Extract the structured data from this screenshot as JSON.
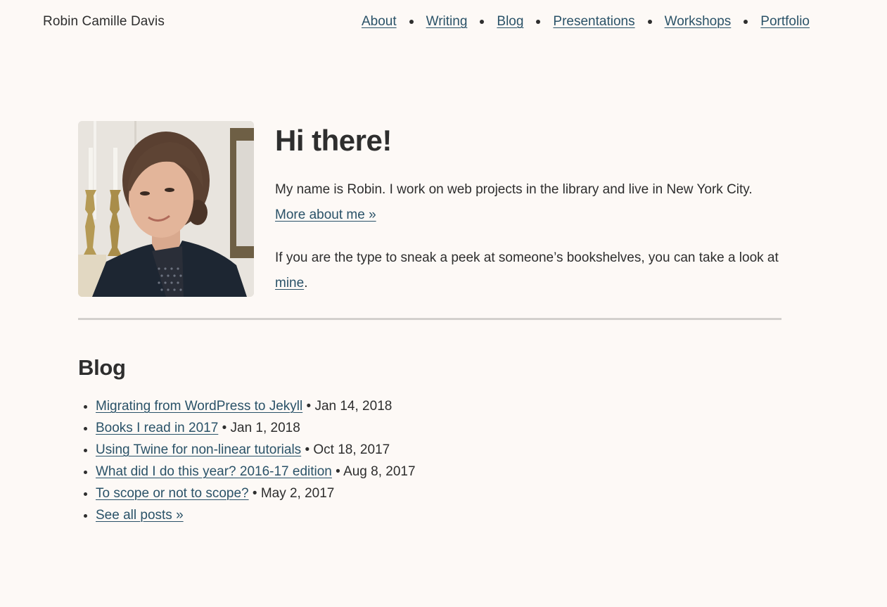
{
  "header": {
    "site_title": "Robin Camille Davis",
    "nav": [
      {
        "label": "About"
      },
      {
        "label": "Writing"
      },
      {
        "label": "Blog"
      },
      {
        "label": "Presentations"
      },
      {
        "label": "Workshops"
      },
      {
        "label": "Portfolio"
      }
    ]
  },
  "intro": {
    "photo_alt": "Portrait of Robin Camille Davis",
    "heading": "Hi there!",
    "p1_text": "My name is Robin. I work on web projects in the library and live in New York City.",
    "p1_link": "More about me »",
    "p2_text": "If you are the type to sneak a peek at someone’s bookshelves, you can take a look at",
    "p2_link": "mine",
    "p2_end": "."
  },
  "blog": {
    "heading": "Blog",
    "separator": "•",
    "posts": [
      {
        "title": "Migrating from WordPress to Jekyll",
        "date": "Jan 14, 2018"
      },
      {
        "title": "Books I read in 2017",
        "date": "Jan 1, 2018"
      },
      {
        "title": "Using Twine for non-linear tutorials",
        "date": "Oct 18, 2017"
      },
      {
        "title": "What did I do this year? 2016-17 edition",
        "date": "Aug 8, 2017"
      },
      {
        "title": "To scope or not to scope?",
        "date": "May 2, 2017"
      }
    ],
    "see_all": "See all posts »"
  },
  "colors": {
    "background": "#fdf9f6",
    "text": "#2e2e2e",
    "link": "#2a5268",
    "divider": "#d3d0cd"
  }
}
